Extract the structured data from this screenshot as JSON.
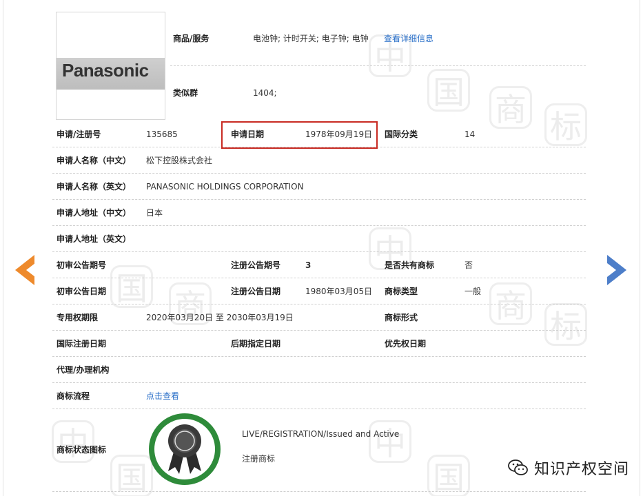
{
  "goods": {
    "goods_label": "商品/服务",
    "goods_value": "电池钟; 计时开关; 电子钟; 电钟",
    "detail_link": "查看详细信息",
    "group_label": "类似群",
    "group_value": "1404;"
  },
  "logo": {
    "text": "Panasonic"
  },
  "fields": {
    "reg_no_label": "申请/注册号",
    "reg_no_value": "135685",
    "app_date_label": "申请日期",
    "app_date_value": "1978年09月19日",
    "intl_class_label": "国际分类",
    "intl_class_value": "14",
    "applicant_cn_label": "申请人名称（中文）",
    "applicant_cn_value": "松下控股株式会社",
    "applicant_en_label": "申请人名称（英文）",
    "applicant_en_value": "PANASONIC HOLDINGS CORPORATION",
    "addr_cn_label": "申请人地址（中文）",
    "addr_cn_value": "日本",
    "addr_en_label": "申请人地址（英文）",
    "prelim_no_label": "初审公告期号",
    "reg_notice_no_label": "注册公告期号",
    "reg_notice_no_value": "3",
    "shared_label": "是否共有商标",
    "shared_value": "否",
    "prelim_date_label": "初审公告日期",
    "reg_notice_date_label": "注册公告日期",
    "reg_notice_date_value": "1980年03月05日",
    "type_label": "商标类型",
    "type_value": "一般",
    "exclusive_label": "专用权期限",
    "exclusive_value": "2020年03月20日 至 2030年03月19日",
    "form_label": "商标形式",
    "intl_reg_date_label": "国际注册日期",
    "later_designation_label": "后期指定日期",
    "priority_label": "优先权日期",
    "agent_label": "代理/办理机构",
    "process_label": "商标流程",
    "process_link": "点击查看",
    "status_label": "商标状态图标",
    "status_en": "LIVE/REGISTRATION/Issued and Active",
    "status_cn": "注册商标"
  },
  "wechat": {
    "name": "知识产权空间"
  },
  "colors": {
    "link": "#2a6fc8",
    "highlight": "#c82a22",
    "prev_arrow": "#ee8a2c",
    "next_arrow": "#4d7ec9",
    "badge_ring": "#2e8b3a"
  }
}
